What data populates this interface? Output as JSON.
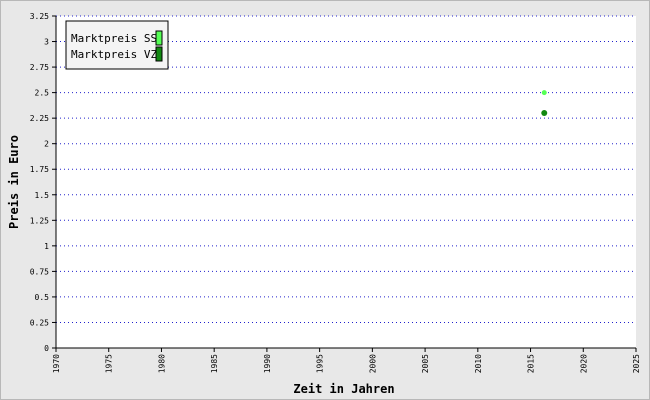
{
  "chart_data": {
    "type": "scatter",
    "title": "",
    "xlabel": "Zeit in Jahren",
    "ylabel": "Preis in Euro",
    "xlim": [
      1970,
      2025
    ],
    "ylim": [
      0,
      3.25
    ],
    "x_ticks": [
      "1970",
      "1975",
      "1980",
      "1985",
      "1990",
      "1995",
      "2000",
      "2005",
      "2010",
      "2015",
      "2020",
      "2025"
    ],
    "y_ticks": [
      "0",
      "0.25",
      "0.5",
      "0.75",
      "1",
      "1.25",
      "1.5",
      "1.75",
      "2",
      "2.25",
      "2.5",
      "2.75",
      "3",
      "3.25"
    ],
    "grid": "horizontal",
    "legend_position": "top-left",
    "series": [
      {
        "name": "Marktpreis SS",
        "color": "#55ff55",
        "points": [
          {
            "x": 2016.3,
            "y": 2.5
          }
        ]
      },
      {
        "name": "Marktpreis VZ",
        "color": "#118811",
        "points": [
          {
            "x": 2016.3,
            "y": 2.3
          }
        ]
      }
    ]
  }
}
